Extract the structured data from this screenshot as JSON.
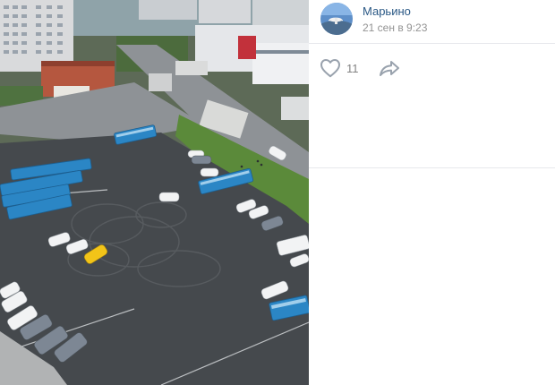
{
  "post": {
    "author": "Марьино",
    "timestamp": "21 сен в 9:23",
    "likes": "11"
  },
  "icons": {
    "like": "heart-outline-icon",
    "share": "share-arrow-icon"
  },
  "colors": {
    "author_link": "#2a5885",
    "meta_text": "#939393",
    "icon": "#99a2ad",
    "divider": "#e7e8ec",
    "bus_blue": "#2b86c5"
  }
}
